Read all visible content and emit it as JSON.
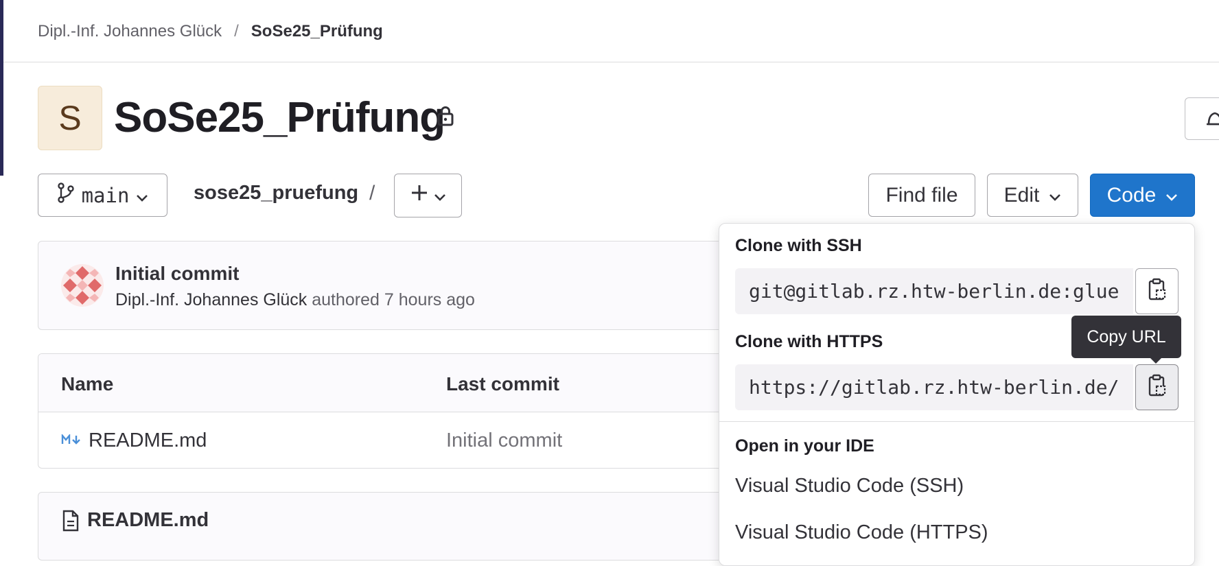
{
  "breadcrumb": {
    "items": [
      "Dipl.-Inf. Johannes Glück",
      "SoSe25_Prüfung"
    ],
    "separator": "/"
  },
  "project": {
    "avatar_letter": "S",
    "name": "SoSe25_Prüfung",
    "visibility_icon": "lock-icon"
  },
  "toolbar": {
    "branch": "main",
    "path": "sose25_pruefung",
    "path_separator": "/",
    "add_label": "+",
    "find_file_label": "Find file",
    "edit_label": "Edit",
    "code_label": "Code"
  },
  "last_commit": {
    "title": "Initial commit",
    "author": "Dipl.-Inf. Johannes Glück",
    "meta": "authored 7 hours ago"
  },
  "file_table": {
    "headers": [
      "Name",
      "Last commit"
    ],
    "rows": [
      {
        "name": "README.md",
        "last_commit": "Initial commit",
        "icon": "markdown-icon"
      }
    ]
  },
  "readme": {
    "title": "README.md"
  },
  "code_dropdown": {
    "ssh_heading": "Clone with SSH",
    "ssh_url": "git@gitlab.rz.htw-berlin.de:glue",
    "https_heading": "Clone with HTTPS",
    "https_url": "https://gitlab.rz.htw-berlin.de/",
    "ide_heading": "Open in your IDE",
    "ide_items": [
      "Visual Studio Code (SSH)",
      "Visual Studio Code (HTTPS)"
    ]
  },
  "tooltip": {
    "text": "Copy URL"
  },
  "colors": {
    "primary": "#1f75cb",
    "sidebar": "#2a2957",
    "avatar_bg": "#f7ecdb",
    "commit_avatar": "#e06a6a"
  }
}
